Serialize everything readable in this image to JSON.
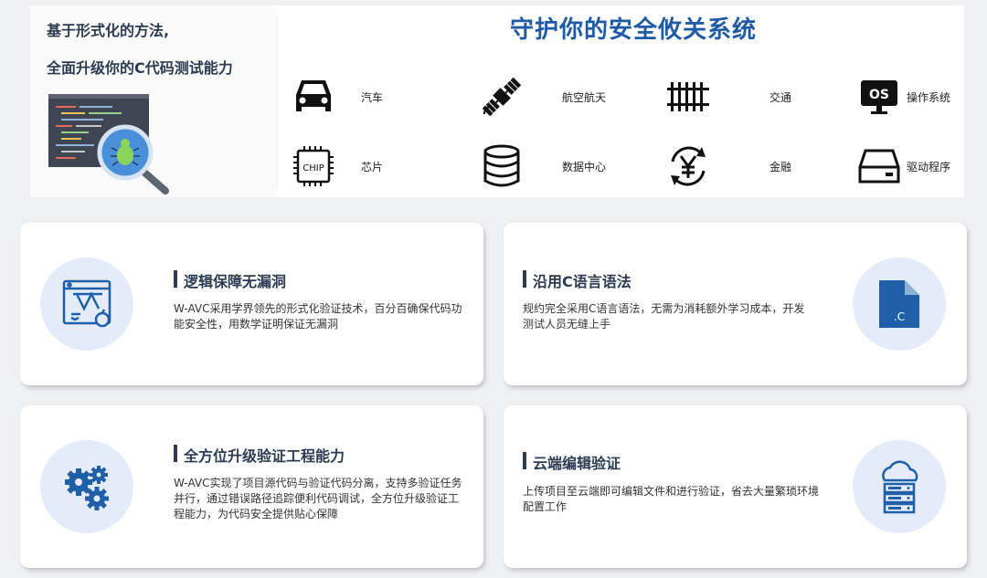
{
  "banner": {
    "headline_line1": "基于形式化的方法,",
    "headline_line2": "全面升级你的C代码测试能力",
    "title": "守护你的安全攸关系统",
    "categories": [
      {
        "label": "汽车",
        "icon": "car-icon"
      },
      {
        "label": "航空航天",
        "icon": "satellite-icon"
      },
      {
        "label": "交通",
        "icon": "railway-track-icon"
      },
      {
        "label": "操作系统",
        "icon": "os-monitor-icon"
      },
      {
        "label": "芯片",
        "icon": "chip-icon"
      },
      {
        "label": "数据中心",
        "icon": "database-icon"
      },
      {
        "label": "金融",
        "icon": "yen-exchange-icon"
      },
      {
        "label": "驱动程序",
        "icon": "hard-drive-icon"
      }
    ],
    "chip_text": "CHIP",
    "os_text": "OS"
  },
  "cards": [
    {
      "title": "逻辑保障无漏洞",
      "desc": "W-AVC采用学界领先的形式化验证技术，百分百确保代码功能安全性，用数学证明保证无漏洞",
      "icon": "blueprint-icon"
    },
    {
      "title": "沿用C语言语法",
      "desc": "规约完全采用C语言语法，无需为消耗额外学习成本，开发测试人员无缝上手",
      "icon": "c-file-icon",
      "file_ext": ".C"
    },
    {
      "title": "全方位升级验证工程能力",
      "desc": "W-AVC实现了项目源代码与验证代码分离，支持多验证任务并行，通过错误路径追踪便利代码调试，全方位升级验证工程能力，为代码安全提供贴心保障",
      "icon": "gears-icon"
    },
    {
      "title": "云端编辑验证",
      "desc": "上传项目至云端即可编辑文件和进行验证，省去大量繁琐环境配置工作",
      "icon": "cloud-server-icon"
    }
  ],
  "colors": {
    "accent_blue": "#1f5aa6",
    "icon_blue": "#1e5fa8",
    "title_dark": "#2c3b52",
    "circle_bg": "#e3ecf8"
  }
}
